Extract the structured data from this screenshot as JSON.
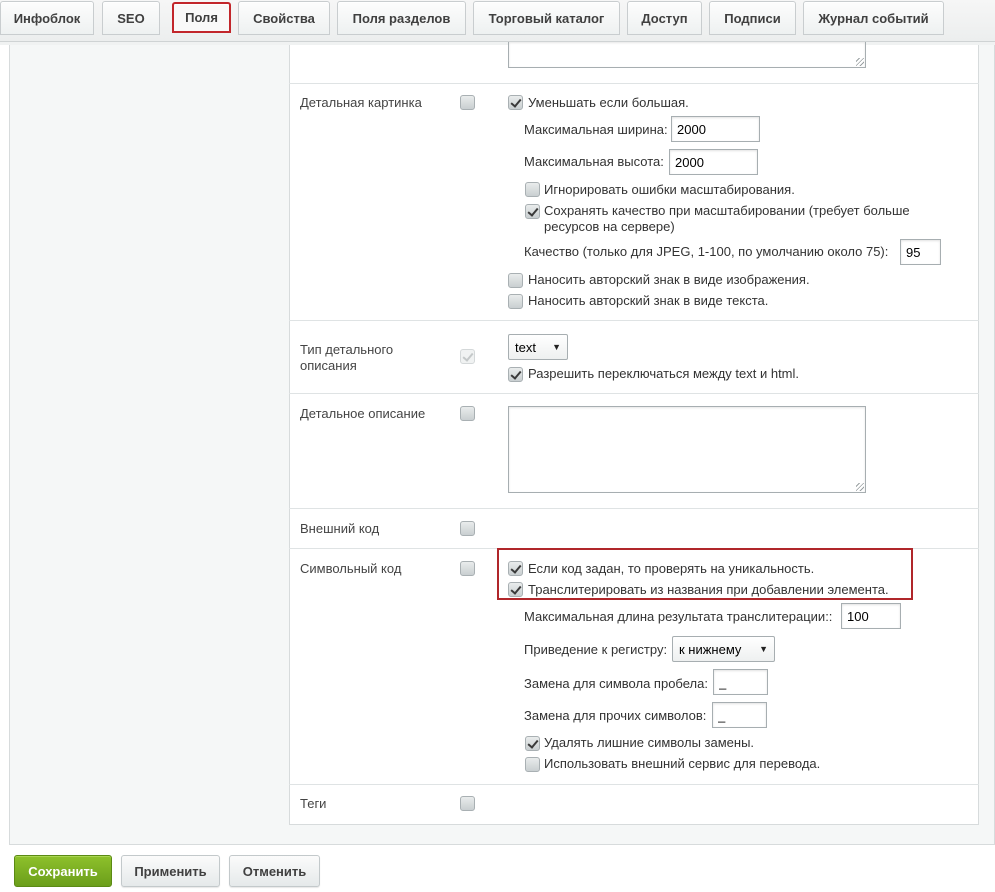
{
  "tabs": [
    {
      "label": "Инфоблок"
    },
    {
      "label": "SEO"
    },
    {
      "label": "Поля",
      "active": true
    },
    {
      "label": "Свойства"
    },
    {
      "label": "Поля разделов"
    },
    {
      "label": "Торговый каталог"
    },
    {
      "label": "Доступ"
    },
    {
      "label": "Подписи"
    },
    {
      "label": "Журнал событий"
    }
  ],
  "rows": {
    "detail_picture": {
      "label": "Детальная картинка",
      "required": false,
      "opt_shrink": {
        "label": "Уменьшать если большая.",
        "checked": true
      },
      "max_width_label": "Максимальная ширина:",
      "max_width_value": "2000",
      "max_height_label": "Максимальная высота:",
      "max_height_value": "2000",
      "opt_ignore_errors": {
        "label": "Игнорировать ошибки масштабирования.",
        "checked": false
      },
      "opt_keep_quality": {
        "label": "Сохранять качество при масштабировании (требует больше ресурсов на сервере)",
        "checked": true
      },
      "quality_label": "Качество (только для JPEG, 1-100, по умолчанию около 75):",
      "quality_value": "95",
      "opt_watermark_image": {
        "label": "Наносить авторский знак в виде изображения.",
        "checked": false
      },
      "opt_watermark_text": {
        "label": "Наносить авторский знак в виде текста.",
        "checked": false
      }
    },
    "detail_text_type": {
      "label": "Тип детального описания",
      "required": true,
      "select_value": "text",
      "opt_allow_switch": {
        "label": "Разрешить переключаться между text и html.",
        "checked": true
      }
    },
    "detail_text": {
      "label": "Детальное описание",
      "required": false
    },
    "external_code": {
      "label": "Внешний код",
      "required": false
    },
    "symbol_code": {
      "label": "Символьный код",
      "required": false,
      "opt_unique": {
        "label": "Если код задан, то проверять на уникальность.",
        "checked": true
      },
      "opt_translit": {
        "label": "Транслитерировать из названия при добавлении элемента.",
        "checked": true
      },
      "max_len_label": "Максимальная длина результата транслитерации::",
      "max_len_value": "100",
      "case_label": "Приведение к регистру:",
      "case_value": "к нижнему",
      "space_label": "Замена для символа пробела:",
      "space_value": "_",
      "other_label": "Замена для прочих символов:",
      "other_value": "_",
      "opt_remove_extra": {
        "label": "Удалять лишние символы замены.",
        "checked": true
      },
      "opt_external_service": {
        "label": "Использовать внешний сервис для перевода.",
        "checked": false
      }
    },
    "tags": {
      "label": "Теги",
      "required": false
    }
  },
  "buttons": {
    "save": "Сохранить",
    "apply": "Применить",
    "cancel": "Отменить"
  },
  "colors": {
    "accent_green": "#7aad22",
    "highlight_red": "#b0262a"
  }
}
